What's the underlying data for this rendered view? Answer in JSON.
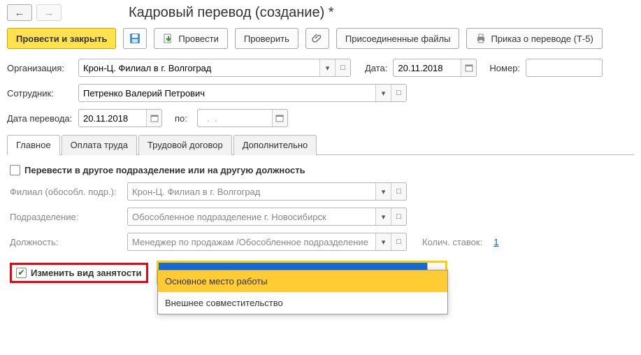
{
  "header": {
    "title": "Кадровый перевод (создание) *"
  },
  "toolbar": {
    "post_and_close": "Провести и закрыть",
    "post": "Провести",
    "check": "Проверить",
    "attached_files": "Присоединенные файлы",
    "print_order": "Приказ о переводе (Т-5)"
  },
  "fields": {
    "org_label": "Организация:",
    "org_value": "Крон-Ц. Филиал в г. Волгоград",
    "date_label": "Дата:",
    "date_value": "20.11.2018",
    "number_label": "Номер:",
    "number_value": "",
    "employee_label": "Сотрудник:",
    "employee_value": "Петренко Валерий Петрович",
    "transfer_date_label": "Дата перевода:",
    "transfer_date_value": "20.11.2018",
    "to_label": "по:",
    "to_value": "  .  .",
    "tabs": [
      "Главное",
      "Оплата труда",
      "Трудовой договор",
      "Дополнительно"
    ]
  },
  "main_tab": {
    "transfer_checkbox_label": "Перевести в другое подразделение или на другую должность",
    "branch_label": "Филиал (обособл. подр.):",
    "branch_value": "Крон-Ц. Филиал в г. Волгоград",
    "department_label": "Подразделение:",
    "department_value": "Обособленное подразделение г. Новосибирск",
    "position_label": "Должность:",
    "position_value": "Менеджер по продажам /Обособленное подразделение г. Н",
    "rates_label": "Колич. ставок:",
    "rates_value": "1",
    "employment_checkbox_label": "Изменить вид занятости",
    "employment_value": "Внешнее совместительство",
    "employment_options": [
      "Основное место работы",
      "Внешнее совместительство"
    ]
  }
}
